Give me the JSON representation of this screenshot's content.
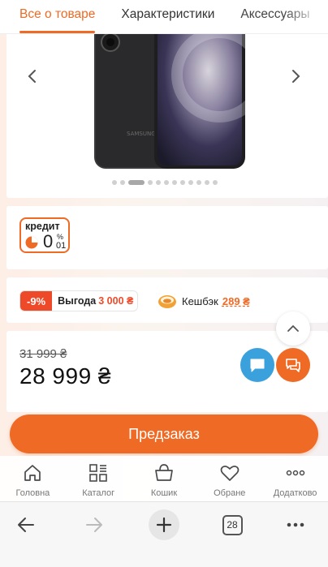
{
  "tabs": [
    {
      "label": "Все о товаре",
      "active": true
    },
    {
      "label": "Характеристики",
      "active": false
    },
    {
      "label": "Аксессуары",
      "active": false
    }
  ],
  "gallery": {
    "brand_on_device": "SAMSUNG",
    "dot_count": 12,
    "active_dot_index": 2
  },
  "credit": {
    "label": "кредит",
    "value_main": "0",
    "value_percent": "%",
    "value_small": "01"
  },
  "benefits": {
    "discount_percent": "-9%",
    "savings_label": "Выгода",
    "savings_value": "3 000 ₴",
    "cashback_label": "Кешбэк",
    "cashback_value": "289 ₴"
  },
  "price": {
    "old": "31 999 ₴",
    "current": "28 999 ₴"
  },
  "actions": {
    "preorder_label": "Предзаказ"
  },
  "bottom_nav": [
    {
      "label": "Головна",
      "icon": "home-icon"
    },
    {
      "label": "Каталог",
      "icon": "catalog-icon"
    },
    {
      "label": "Кошик",
      "icon": "cart-icon"
    },
    {
      "label": "Обране",
      "icon": "heart-icon"
    },
    {
      "label": "Додатково",
      "icon": "more-icon"
    }
  ],
  "browser": {
    "tab_count": "28"
  },
  "colors": {
    "accent": "#ef6a25",
    "discount": "#ee4a2a",
    "chat_blue": "#3aa1dc"
  }
}
